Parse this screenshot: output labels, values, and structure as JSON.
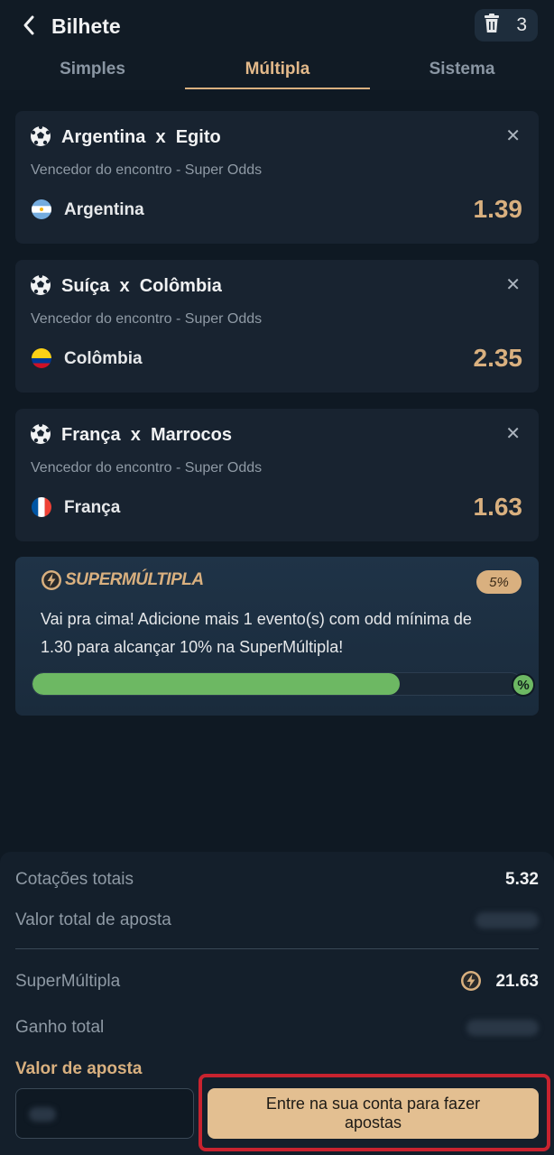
{
  "header": {
    "title": "Bilhete",
    "bet_count": "3"
  },
  "tabs": [
    {
      "label": "Simples",
      "active": false
    },
    {
      "label": "Múltipla",
      "active": true
    },
    {
      "label": "Sistema",
      "active": false
    }
  ],
  "selections": [
    {
      "home": "Argentina",
      "separator": "x",
      "away": "Egito",
      "market": "Vencedor do encontro - Super Odds",
      "pick": "Argentina",
      "odd": "1.39",
      "flag": "argentina-flag-icon"
    },
    {
      "home": "Suíça",
      "separator": "x",
      "away": "Colômbia",
      "market": "Vencedor do encontro - Super Odds",
      "pick": "Colômbia",
      "odd": "2.35",
      "flag": "colombia-flag-icon"
    },
    {
      "home": "França",
      "separator": "x",
      "away": "Marrocos",
      "market": "Vencedor do encontro - Super Odds",
      "pick": "França",
      "odd": "1.63",
      "flag": "france-flag-icon"
    }
  ],
  "promo": {
    "brand": "SUPERMÚLTIPLA",
    "badge": "5%",
    "message": "Vai pra cima! Adicione mais 1 evento(s) com odd mínima de 1.30 para alcançar 10% na SuperMúltipla!",
    "progress_percent": 75,
    "end_icon": "%"
  },
  "summary": {
    "total_odds_label": "Cotações totais",
    "total_odds_value": "5.32",
    "total_stake_label": "Valor total de aposta",
    "supermultipla_label": "SuperMúltipla",
    "supermultipla_value": "21.63",
    "total_win_label": "Ganho total",
    "stake_label": "Valor de aposta",
    "login_button": "Entre na sua conta para fazer apostas"
  },
  "colors": {
    "accent": "#d9b07f",
    "progress": "#6db863",
    "highlight_border": "#c8232f"
  }
}
